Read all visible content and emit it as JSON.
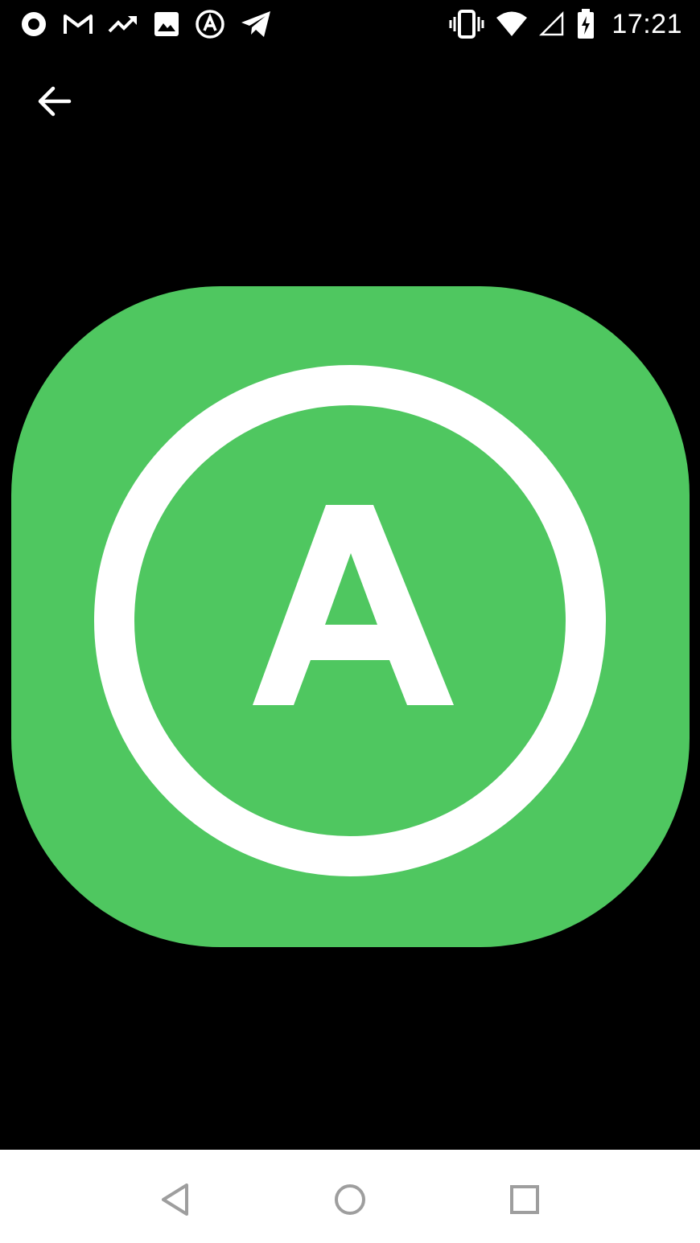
{
  "status_bar": {
    "time": "17:21",
    "left_icons": [
      "record-icon",
      "gmail-icon",
      "trending-icon",
      "image-icon",
      "circle-a-icon",
      "telegram-icon"
    ],
    "right_icons": [
      "vibrate-icon",
      "wifi-icon",
      "signal-icon",
      "battery-charging-icon"
    ]
  },
  "toolbar": {
    "back_icon": "arrow-left-icon"
  },
  "image": {
    "letter": "A",
    "background_color": "#4fc760",
    "foreground_color": "#ffffff"
  },
  "nav_bar": {
    "buttons": [
      "back-triangle-icon",
      "home-circle-icon",
      "recents-square-icon"
    ]
  },
  "colors": {
    "screen_bg": "#000000",
    "status_fg": "#ffffff",
    "nav_bg": "#ffffff",
    "nav_fg": "#9e9e9e"
  }
}
